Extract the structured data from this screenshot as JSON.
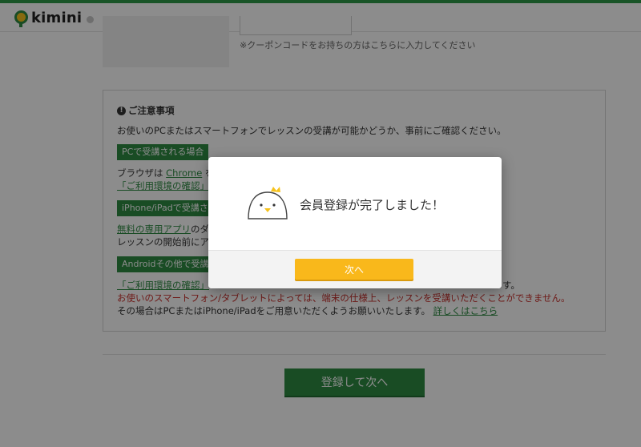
{
  "header": {
    "logo_text": "kimini"
  },
  "coupon": {
    "note": "※クーポンコードをお持ちの方はこちらに入力してください"
  },
  "notice": {
    "title": "ご注意事項",
    "intro": "お使いのPCまたはスマートフォンでレッスンの受講が可能かどうか、事前にご確認ください。",
    "pc": {
      "tag": "PCで受講される場合",
      "line1_prefix": "ブラウザは ",
      "line1_link": "Chrome",
      "line1_suffix": " を",
      "line2_link": "「ご利用環境の確認」"
    },
    "ios": {
      "tag": "iPhone/iPadで受講され",
      "line1_link": "無料の専用アプリ",
      "line1_suffix": "のダ",
      "line2": "レッスンの開始前にア"
    },
    "android": {
      "tag": "Androidその他で受講さ",
      "line1_link": "「ご利用環境の確認」",
      "line1_suffix": "す。",
      "red_line": "お使いのスマートフォン/タブレットによっては、端末の仕様上、レッスンを受講いただくことができません。",
      "last_line_prefix": "その場合はPCまたはiPhone/iPadをご用意いただくようお願いいたします。",
      "last_line_link": "詳しくはこちら"
    }
  },
  "register_button": "登録して次へ",
  "modal": {
    "message": "会員登録が完了しました！",
    "next_button": "次へ"
  },
  "colors": {
    "brand_green": "#2e8a43",
    "accent_yellow": "#f9b81b",
    "warning_red": "#c9302c"
  }
}
